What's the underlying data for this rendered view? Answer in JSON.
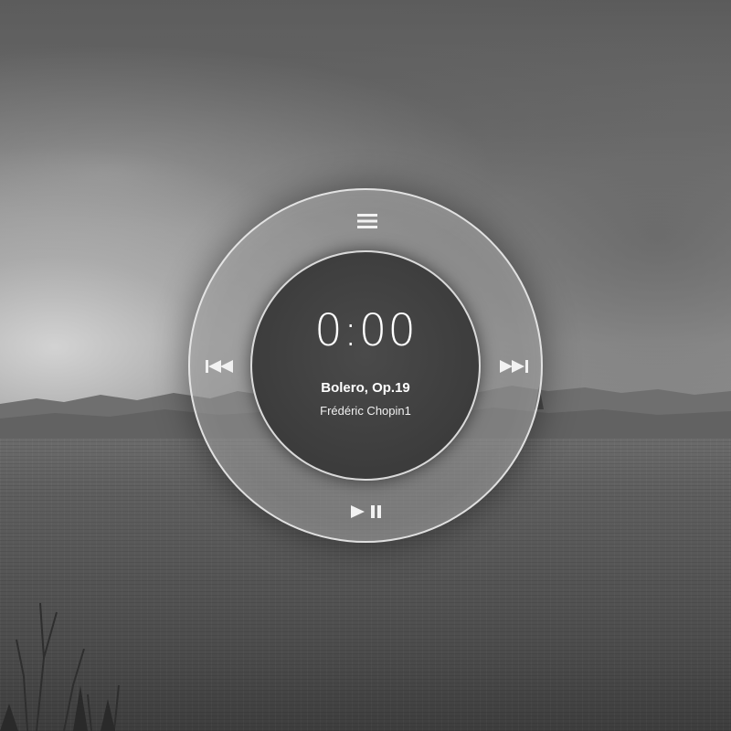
{
  "player": {
    "time": "0:00",
    "track_title": "Bolero, Op.19",
    "track_artist": "Frédéric Chopin1"
  },
  "controls": {
    "menu_icon": "hamburger-menu-icon",
    "prev_icon": "skip-previous-icon",
    "next_icon": "skip-next-icon",
    "play_pause_icon": "play-pause-icon"
  },
  "colors": {
    "ring_border": "#ebebeb",
    "text": "#ffffff",
    "inner_disc": "#3e3e3e"
  }
}
